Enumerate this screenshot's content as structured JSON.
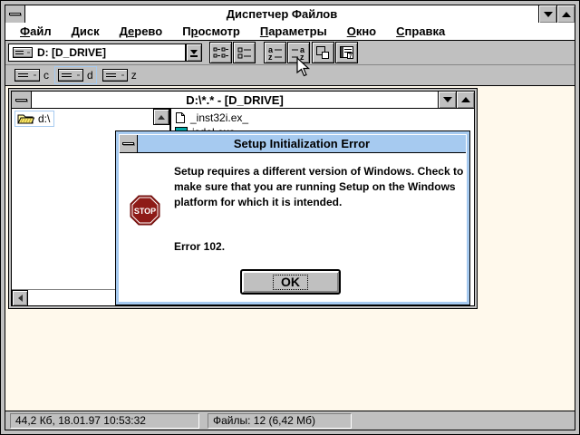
{
  "colors": {
    "window_gray": "#C0C0C0",
    "active_title_blue": "#A6CAF0",
    "desktop_cream": "#FFF9EC",
    "stop_red": "#8E1B17",
    "app_icon_teal": "#00A8A8"
  },
  "main_window": {
    "title": "Диспетчер Файлов",
    "menu": {
      "items": [
        {
          "pre": "",
          "accel": "Ф",
          "post": "айл"
        },
        {
          "pre": "",
          "accel": "Д",
          "post": "иск"
        },
        {
          "pre": "Д",
          "accel": "е",
          "post": "рево"
        },
        {
          "pre": "П",
          "accel": "р",
          "post": "осмотр"
        },
        {
          "pre": "",
          "accel": "П",
          "post": "араметры"
        },
        {
          "pre": "",
          "accel": "О",
          "post": "кно"
        },
        {
          "pre": "",
          "accel": "С",
          "post": "правка"
        }
      ]
    },
    "toolbar": {
      "drive_selector": {
        "value": "D: [D_DRIVE]",
        "icon": "drive-icon"
      },
      "buttons": [
        {
          "icon": "view-details-icon"
        },
        {
          "icon": "view-names-icon"
        },
        {
          "icon": "sort-by-name-icon"
        },
        {
          "icon": "sort-by-type-icon"
        },
        {
          "icon": "copy-icon"
        },
        {
          "icon": "window-layout-icon"
        }
      ]
    },
    "drivebar": {
      "drives": [
        {
          "label": "c",
          "selected": false
        },
        {
          "label": "d",
          "selected": true
        },
        {
          "label": "z",
          "selected": false
        }
      ]
    },
    "statusbar": {
      "left": "44,2 Кб, 18.01.97 10:53:32",
      "right": "Файлы: 12 (6,42 Мб)"
    }
  },
  "child_window": {
    "title": "D:\\*.* - [D_DRIVE]",
    "tree": {
      "items": [
        {
          "label": "d:\\",
          "icon": "folder-open-icon"
        }
      ]
    },
    "files": [
      {
        "name": "_inst32i.ex_",
        "icon": "document-icon"
      },
      {
        "name": "isdel.exe",
        "icon": "application-icon"
      }
    ]
  },
  "dialog": {
    "title": "Setup Initialization Error",
    "message": "Setup requires a different version of Windows. Check to make sure that you are running Setup on the Windows platform for which it is intended.",
    "error_line": "Error 102.",
    "ok_label": "OK",
    "stop_label": "STOP"
  }
}
